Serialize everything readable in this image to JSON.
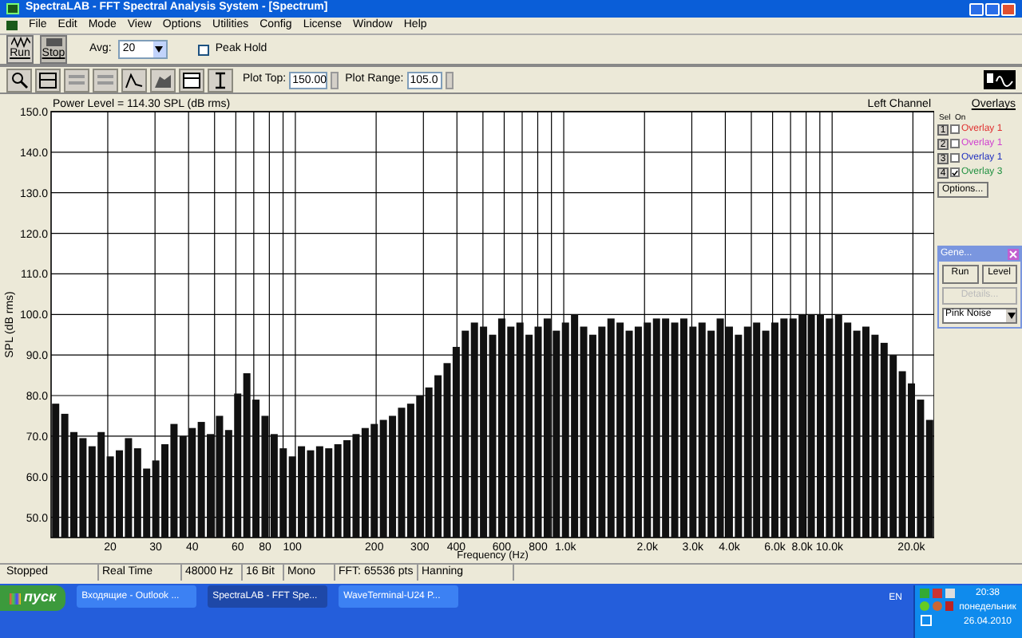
{
  "window": {
    "title": "SpectraLAB - FFT Spectral Analysis System - [Spectrum]"
  },
  "menu": [
    "File",
    "Edit",
    "Mode",
    "View",
    "Options",
    "Utilities",
    "Config",
    "License",
    "Window",
    "Help"
  ],
  "toolbar": {
    "run": "Run",
    "stop": "Stop",
    "avg_label": "Avg:",
    "avg_value": "20",
    "peak_hold": {
      "label": "Peak Hold",
      "checked": false
    },
    "plot_top": {
      "label": "Plot Top:",
      "value": "150.00"
    },
    "plot_range": {
      "label": "Plot Range:",
      "value": "105.0"
    }
  },
  "chart": {
    "power_level": "Power Level = 114.30 SPL (dB rms)",
    "channel": "Left Channel",
    "chart_data": {
      "type": "bar",
      "grid": true,
      "categories": [
        null,
        null,
        null,
        null,
        null,
        null,
        "20",
        null,
        null,
        null,
        null,
        "30",
        null,
        null,
        null,
        "40",
        null,
        null,
        null,
        null,
        "60",
        null,
        null,
        "80",
        null,
        null,
        "100",
        null,
        null,
        null,
        null,
        null,
        null,
        null,
        null,
        "200",
        null,
        null,
        null,
        null,
        "300",
        null,
        null,
        null,
        "400",
        null,
        null,
        null,
        null,
        "600",
        null,
        null,
        null,
        "800",
        null,
        null,
        "1.0k",
        null,
        null,
        null,
        null,
        null,
        null,
        null,
        null,
        "2.0k",
        null,
        null,
        null,
        null,
        "3.0k",
        null,
        null,
        null,
        "4.0k",
        null,
        null,
        null,
        null,
        "6.0k",
        null,
        null,
        "8.0k",
        null,
        null,
        "10.0k",
        null,
        null,
        null,
        null,
        null,
        null,
        null,
        null,
        "20.0k",
        null,
        null
      ],
      "xlabel": "Frequency (Hz)",
      "ylabel": "SPL (dB rms)",
      "ylim": [
        45,
        150
      ],
      "values": [
        78,
        75.5,
        71,
        69.5,
        67.5,
        71,
        65,
        66.5,
        69.5,
        67,
        62,
        64,
        68,
        73,
        70,
        72,
        73.5,
        70.5,
        75,
        71.5,
        80.5,
        85.5,
        79,
        75,
        70.5,
        67,
        65,
        67.5,
        66.5,
        67.5,
        67,
        68,
        69,
        70.5,
        72,
        73,
        74,
        75,
        77,
        78,
        80,
        82,
        85,
        88,
        92,
        96,
        98,
        97,
        95,
        99,
        97,
        98,
        95,
        97,
        99,
        96,
        98,
        100,
        97,
        95,
        97,
        99,
        98,
        96,
        97,
        98,
        99,
        99,
        98,
        99,
        97,
        98,
        96,
        99,
        97,
        95,
        97,
        98,
        96,
        98,
        99,
        99,
        100,
        100,
        100,
        99,
        100,
        98,
        96,
        97,
        95,
        93,
        90,
        86,
        83,
        79,
        74
      ],
      "yticks": [
        {
          "value": 50,
          "label": "50.0"
        },
        {
          "value": 60,
          "label": "60.0"
        },
        {
          "value": 70,
          "label": "70.0"
        },
        {
          "value": 80,
          "label": "80.0"
        },
        {
          "value": 90,
          "label": "90.0"
        },
        {
          "value": 100,
          "label": "100.0"
        },
        {
          "value": 110,
          "label": "110.0"
        },
        {
          "value": 120,
          "label": "120.0"
        },
        {
          "value": 130,
          "label": "130.0"
        },
        {
          "value": 140,
          "label": "140.0"
        },
        {
          "value": 150,
          "label": "150.0"
        }
      ]
    }
  },
  "overlays": {
    "title": "Overlays",
    "sel_header": "Sel",
    "on_header": "On",
    "options": "Options...",
    "items": [
      {
        "number": "1",
        "checked": false,
        "label": "Overlay 1",
        "color": "#e03030"
      },
      {
        "number": "2",
        "checked": false,
        "label": "Overlay 1",
        "color": "#d040d0"
      },
      {
        "number": "3",
        "checked": false,
        "label": "Overlay 1",
        "color": "#2030c0"
      },
      {
        "number": "4",
        "checked": true,
        "label": "Overlay 3",
        "color": "#209040"
      }
    ]
  },
  "generator": {
    "title": "Gene...",
    "run": "Run",
    "level": "Level",
    "details": {
      "label": "Details...",
      "disabled": true
    },
    "signal": "Pink Noise"
  },
  "status_bar": [
    "Stopped",
    "Real Time",
    "48000 Hz",
    "16 Bit",
    "Mono",
    "FFT: 65536 pts",
    "Hanning"
  ],
  "taskbar": {
    "start": "пуск",
    "tasks": [
      {
        "label": "Входящие - Outlook ...",
        "selected": false
      },
      {
        "label": "SpectraLAB - FFT Spe...",
        "selected": true
      },
      {
        "label": "WaveTerminal-U24 P...",
        "selected": false
      }
    ],
    "language": "EN",
    "time": "20:38",
    "day": "понедельник",
    "date": "26.04.2010"
  }
}
